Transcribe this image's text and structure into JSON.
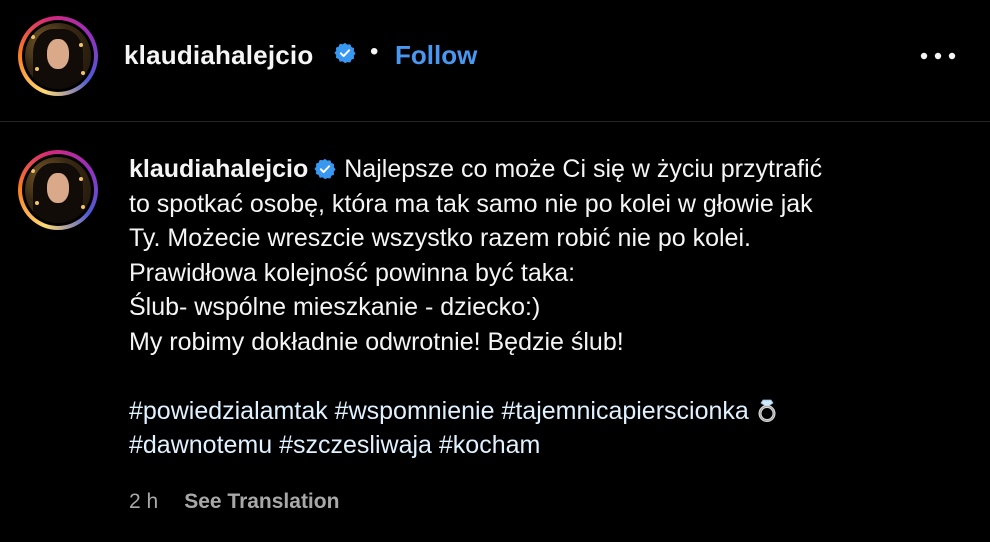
{
  "header": {
    "username": "klaudiahalejcio",
    "separator": "•",
    "follow_label": "Follow"
  },
  "post": {
    "username": "klaudiahalejcio",
    "caption_lines": [
      "Najlepsze co może Ci się w życiu przytrafić",
      "to spotkać osobę, która ma tak samo nie po kolei w głowie jak",
      "Ty. Możecie wreszcie wszystko razem robić nie po kolei.",
      "Prawidłowa kolejność powinna być taka:",
      "Ślub- wspólne mieszkanie - dziecko:)",
      "My robimy dokładnie odwrotnie! Będzie ślub!"
    ],
    "hashtags_line1": [
      "#powiedzialamtak",
      "#wspomnienie",
      "#tajemnicapierscionka"
    ],
    "hashtags_line2": [
      "#dawnotemu",
      "#szczesliwaja",
      "#kocham"
    ],
    "timestamp": "2 h",
    "see_translation": "See Translation"
  },
  "colors": {
    "background": "#000000",
    "text": "#f5f5f5",
    "follow": "#4a97f0",
    "verified": "#3897f0",
    "muted": "#a8a8a8",
    "divider": "#262626"
  },
  "icons": {
    "verified": "verified-badge-icon",
    "more": "more-options-icon",
    "ring": "ring-emoji-icon"
  }
}
